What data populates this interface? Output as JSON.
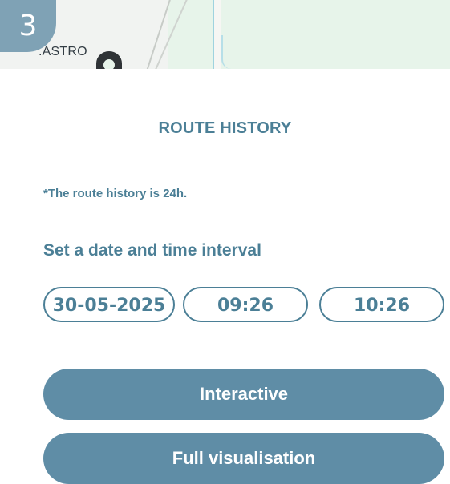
{
  "step": {
    "number": "3"
  },
  "map": {
    "place_label": ".ASTRO"
  },
  "panel": {
    "title": "ROUTE HISTORY",
    "note": "*The route history is 24h.",
    "subheading": "Set a date and time interval",
    "date": "30-05-2025",
    "start_time": "09:26",
    "end_time": "10:26"
  },
  "actions": {
    "interactive": "Interactive",
    "full_visualisation": "Full visualisation"
  },
  "colors": {
    "accent": "#4b7f96",
    "button": "#5f8da6",
    "badge": "#7fa2b5",
    "map_green": "#e7f4ea"
  }
}
